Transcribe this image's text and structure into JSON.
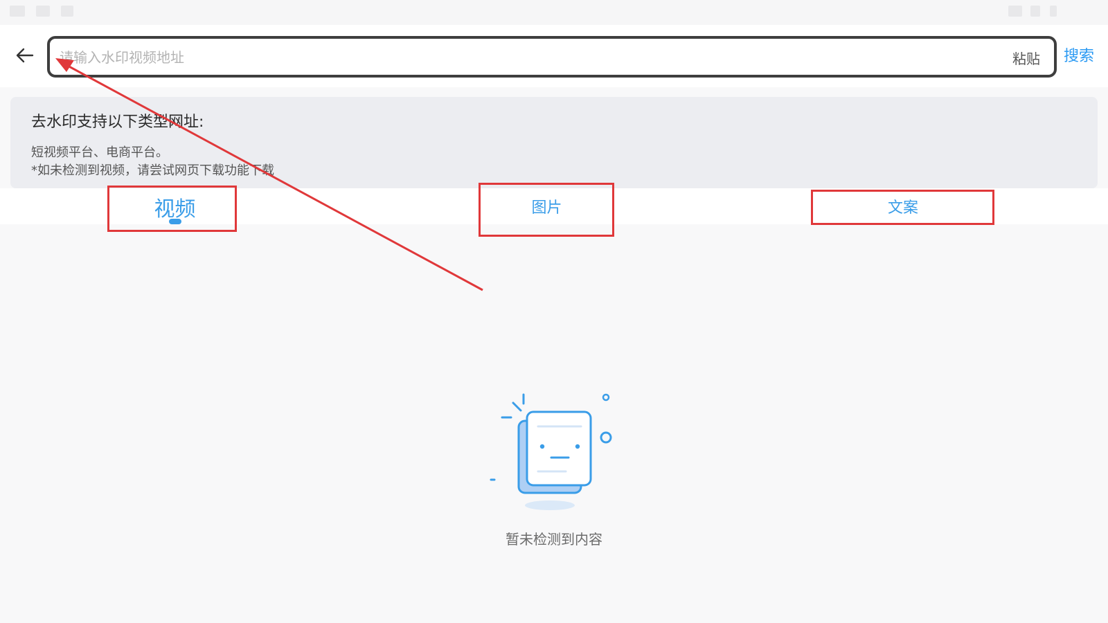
{
  "search": {
    "placeholder": "请输入水印视频地址",
    "paste_label": "粘贴",
    "search_label": "搜索"
  },
  "info": {
    "title": "去水印支持以下类型网址:",
    "line1": "短视频平台、电商平台。",
    "line2": "*如未检测到视频，请尝试网页下载功能下载"
  },
  "tabs": [
    {
      "label": "视频",
      "active": true
    },
    {
      "label": "图片",
      "active": false
    },
    {
      "label": "文案",
      "active": false
    }
  ],
  "empty_state": {
    "text": "暂未检测到内容"
  },
  "colors": {
    "accent": "#2b9af3",
    "annotation": "#e0383a",
    "panel": "#ecedf1",
    "page_background": "#f8f8f9"
  },
  "icons": [
    "back-arrow-icon",
    "empty-document-icon"
  ]
}
